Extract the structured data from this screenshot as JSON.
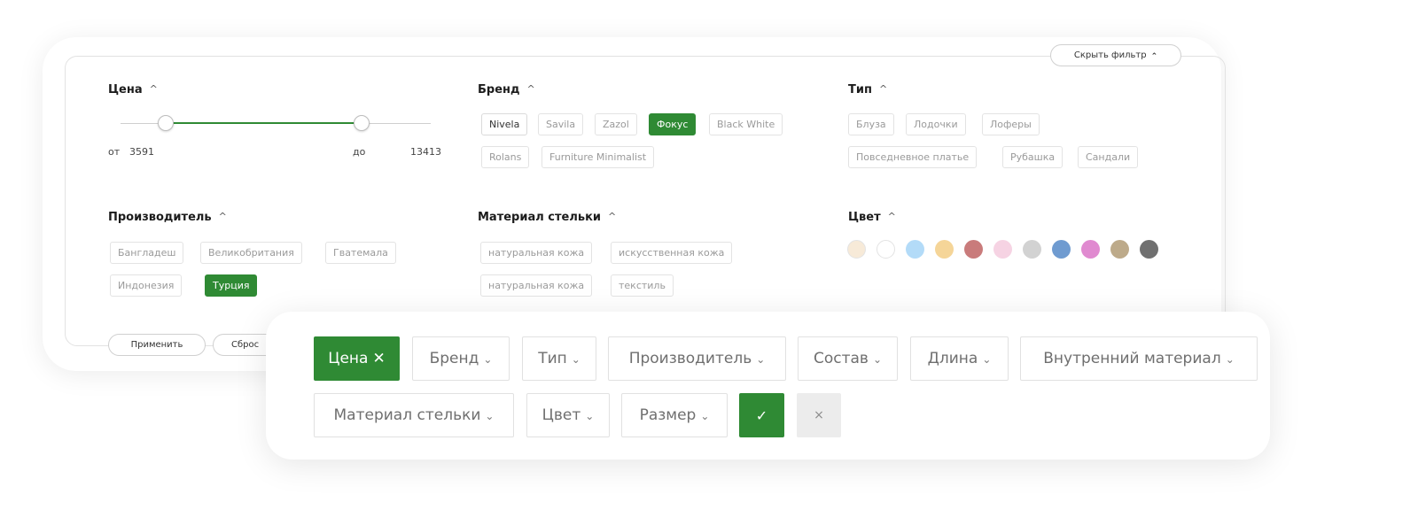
{
  "hide_filter": {
    "label": "Скрыть фильтр",
    "icon": "chevron-up-icon"
  },
  "price": {
    "title": "Цена",
    "from_label": "от",
    "from_value": "3591",
    "to_label": "до",
    "to_value": "13413"
  },
  "brand": {
    "title": "Бренд",
    "chips": [
      "Nivela",
      "Savila",
      "Zazol",
      "Фокус",
      "Black White",
      "Rolans",
      "Furniture Minimalist"
    ],
    "selected": "Фокус"
  },
  "type": {
    "title": "Тип",
    "chips": [
      "Блуза",
      "Лодочки",
      "Лоферы",
      "Повседневное платье",
      "Рубашка",
      "Сандали"
    ]
  },
  "manufacturer": {
    "title": "Производитель",
    "chips": [
      "Бангладеш",
      "Великобритания",
      "Гватемала",
      "Индонезия",
      "Турция"
    ],
    "selected": "Турция"
  },
  "insole": {
    "title": "Материал стельки",
    "chips": [
      "натуральная кожа",
      "искусственная кожа",
      "натуральная кожа",
      "текстиль"
    ]
  },
  "color": {
    "title": "Цвет",
    "swatches": [
      "#f7ead8",
      "#ffffff",
      "#b3dbf8",
      "#f5d598",
      "#c97b7b",
      "#f6d3e3",
      "#d2d2d2",
      "#6f9bd0",
      "#e08ad0",
      "#bdaa8a",
      "#707070"
    ]
  },
  "back_actions": {
    "apply": "Применить",
    "reset": "Сброс"
  },
  "compact": {
    "items": [
      "Цена",
      "Бренд",
      "Тип",
      "Производитель",
      "Состав",
      "Длина",
      "Внутренний материал",
      "Материал стельки",
      "Цвет",
      "Размер"
    ],
    "active": "Цена",
    "apply_icon": "✓",
    "clear_icon": "×"
  },
  "colors": {
    "accent": "#2f8a34",
    "chip_border": "#e3e3e3",
    "muted_text": "#9a9a9a"
  }
}
